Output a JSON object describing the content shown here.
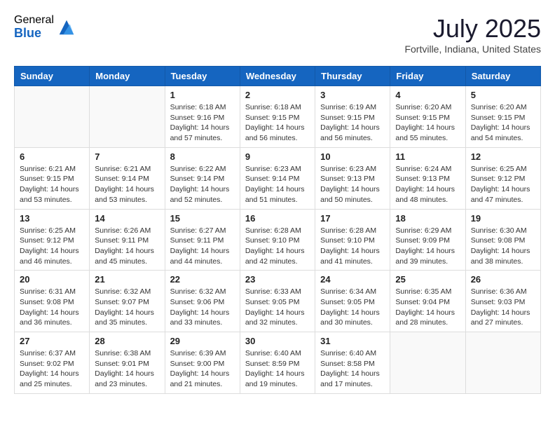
{
  "header": {
    "logo_general": "General",
    "logo_blue": "Blue",
    "month_title": "July 2025",
    "location": "Fortville, Indiana, United States"
  },
  "days_of_week": [
    "Sunday",
    "Monday",
    "Tuesday",
    "Wednesday",
    "Thursday",
    "Friday",
    "Saturday"
  ],
  "weeks": [
    [
      {
        "day": "",
        "sunrise": "",
        "sunset": "",
        "daylight": ""
      },
      {
        "day": "",
        "sunrise": "",
        "sunset": "",
        "daylight": ""
      },
      {
        "day": "1",
        "sunrise": "Sunrise: 6:18 AM",
        "sunset": "Sunset: 9:16 PM",
        "daylight": "Daylight: 14 hours and 57 minutes."
      },
      {
        "day": "2",
        "sunrise": "Sunrise: 6:18 AM",
        "sunset": "Sunset: 9:15 PM",
        "daylight": "Daylight: 14 hours and 56 minutes."
      },
      {
        "day": "3",
        "sunrise": "Sunrise: 6:19 AM",
        "sunset": "Sunset: 9:15 PM",
        "daylight": "Daylight: 14 hours and 56 minutes."
      },
      {
        "day": "4",
        "sunrise": "Sunrise: 6:20 AM",
        "sunset": "Sunset: 9:15 PM",
        "daylight": "Daylight: 14 hours and 55 minutes."
      },
      {
        "day": "5",
        "sunrise": "Sunrise: 6:20 AM",
        "sunset": "Sunset: 9:15 PM",
        "daylight": "Daylight: 14 hours and 54 minutes."
      }
    ],
    [
      {
        "day": "6",
        "sunrise": "Sunrise: 6:21 AM",
        "sunset": "Sunset: 9:15 PM",
        "daylight": "Daylight: 14 hours and 53 minutes."
      },
      {
        "day": "7",
        "sunrise": "Sunrise: 6:21 AM",
        "sunset": "Sunset: 9:14 PM",
        "daylight": "Daylight: 14 hours and 53 minutes."
      },
      {
        "day": "8",
        "sunrise": "Sunrise: 6:22 AM",
        "sunset": "Sunset: 9:14 PM",
        "daylight": "Daylight: 14 hours and 52 minutes."
      },
      {
        "day": "9",
        "sunrise": "Sunrise: 6:23 AM",
        "sunset": "Sunset: 9:14 PM",
        "daylight": "Daylight: 14 hours and 51 minutes."
      },
      {
        "day": "10",
        "sunrise": "Sunrise: 6:23 AM",
        "sunset": "Sunset: 9:13 PM",
        "daylight": "Daylight: 14 hours and 50 minutes."
      },
      {
        "day": "11",
        "sunrise": "Sunrise: 6:24 AM",
        "sunset": "Sunset: 9:13 PM",
        "daylight": "Daylight: 14 hours and 48 minutes."
      },
      {
        "day": "12",
        "sunrise": "Sunrise: 6:25 AM",
        "sunset": "Sunset: 9:12 PM",
        "daylight": "Daylight: 14 hours and 47 minutes."
      }
    ],
    [
      {
        "day": "13",
        "sunrise": "Sunrise: 6:25 AM",
        "sunset": "Sunset: 9:12 PM",
        "daylight": "Daylight: 14 hours and 46 minutes."
      },
      {
        "day": "14",
        "sunrise": "Sunrise: 6:26 AM",
        "sunset": "Sunset: 9:11 PM",
        "daylight": "Daylight: 14 hours and 45 minutes."
      },
      {
        "day": "15",
        "sunrise": "Sunrise: 6:27 AM",
        "sunset": "Sunset: 9:11 PM",
        "daylight": "Daylight: 14 hours and 44 minutes."
      },
      {
        "day": "16",
        "sunrise": "Sunrise: 6:28 AM",
        "sunset": "Sunset: 9:10 PM",
        "daylight": "Daylight: 14 hours and 42 minutes."
      },
      {
        "day": "17",
        "sunrise": "Sunrise: 6:28 AM",
        "sunset": "Sunset: 9:10 PM",
        "daylight": "Daylight: 14 hours and 41 minutes."
      },
      {
        "day": "18",
        "sunrise": "Sunrise: 6:29 AM",
        "sunset": "Sunset: 9:09 PM",
        "daylight": "Daylight: 14 hours and 39 minutes."
      },
      {
        "day": "19",
        "sunrise": "Sunrise: 6:30 AM",
        "sunset": "Sunset: 9:08 PM",
        "daylight": "Daylight: 14 hours and 38 minutes."
      }
    ],
    [
      {
        "day": "20",
        "sunrise": "Sunrise: 6:31 AM",
        "sunset": "Sunset: 9:08 PM",
        "daylight": "Daylight: 14 hours and 36 minutes."
      },
      {
        "day": "21",
        "sunrise": "Sunrise: 6:32 AM",
        "sunset": "Sunset: 9:07 PM",
        "daylight": "Daylight: 14 hours and 35 minutes."
      },
      {
        "day": "22",
        "sunrise": "Sunrise: 6:32 AM",
        "sunset": "Sunset: 9:06 PM",
        "daylight": "Daylight: 14 hours and 33 minutes."
      },
      {
        "day": "23",
        "sunrise": "Sunrise: 6:33 AM",
        "sunset": "Sunset: 9:05 PM",
        "daylight": "Daylight: 14 hours and 32 minutes."
      },
      {
        "day": "24",
        "sunrise": "Sunrise: 6:34 AM",
        "sunset": "Sunset: 9:05 PM",
        "daylight": "Daylight: 14 hours and 30 minutes."
      },
      {
        "day": "25",
        "sunrise": "Sunrise: 6:35 AM",
        "sunset": "Sunset: 9:04 PM",
        "daylight": "Daylight: 14 hours and 28 minutes."
      },
      {
        "day": "26",
        "sunrise": "Sunrise: 6:36 AM",
        "sunset": "Sunset: 9:03 PM",
        "daylight": "Daylight: 14 hours and 27 minutes."
      }
    ],
    [
      {
        "day": "27",
        "sunrise": "Sunrise: 6:37 AM",
        "sunset": "Sunset: 9:02 PM",
        "daylight": "Daylight: 14 hours and 25 minutes."
      },
      {
        "day": "28",
        "sunrise": "Sunrise: 6:38 AM",
        "sunset": "Sunset: 9:01 PM",
        "daylight": "Daylight: 14 hours and 23 minutes."
      },
      {
        "day": "29",
        "sunrise": "Sunrise: 6:39 AM",
        "sunset": "Sunset: 9:00 PM",
        "daylight": "Daylight: 14 hours and 21 minutes."
      },
      {
        "day": "30",
        "sunrise": "Sunrise: 6:40 AM",
        "sunset": "Sunset: 8:59 PM",
        "daylight": "Daylight: 14 hours and 19 minutes."
      },
      {
        "day": "31",
        "sunrise": "Sunrise: 6:40 AM",
        "sunset": "Sunset: 8:58 PM",
        "daylight": "Daylight: 14 hours and 17 minutes."
      },
      {
        "day": "",
        "sunrise": "",
        "sunset": "",
        "daylight": ""
      },
      {
        "day": "",
        "sunrise": "",
        "sunset": "",
        "daylight": ""
      }
    ]
  ]
}
